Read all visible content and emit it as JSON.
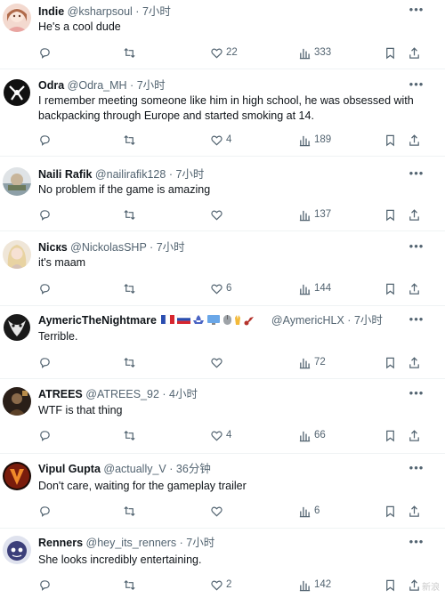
{
  "tweets": [
    {
      "name": "Indie",
      "handle": "@ksharpsoul",
      "time": "7小时",
      "text": "He's a cool dude",
      "likes": "22",
      "views": "333"
    },
    {
      "name": "Odra",
      "handle": "@Odra_MH",
      "time": "7小时",
      "text": "I remember meeting someone like him in high school, he was obsessed with backpacking through Europe and started smoking at 14.",
      "likes": "4",
      "views": "189"
    },
    {
      "name": "Naili Rafik",
      "handle": "@nailirafik128",
      "time": "7小时",
      "text": "No problem if the game is amazing",
      "likes": "",
      "views": "137"
    },
    {
      "name": "Nicкs",
      "handle": "@NickolasSHP",
      "time": "7小时",
      "text": "it's maam",
      "likes": "6",
      "views": "144"
    },
    {
      "name": "AymericTheNightmare",
      "handle": "@AymericHLX",
      "time": "7小时",
      "text": "Terrible.",
      "likes": "",
      "views": "72"
    },
    {
      "name": "ATREES",
      "handle": "@ATREES_92",
      "time": "4小时",
      "text": "WTF is that thing",
      "likes": "4",
      "views": "66"
    },
    {
      "name": "Vipul Gupta",
      "handle": "@actually_V",
      "time": "36分钟",
      "text": "Don't care, waiting for the gameplay trailer",
      "likes": "",
      "views": "6"
    },
    {
      "name": "Renners",
      "handle": "@hey_its_renners",
      "time": "7小时",
      "text": "She looks incredibly entertaining.",
      "likes": "2",
      "views": "142"
    }
  ],
  "separator": "·",
  "watermark": "新浪"
}
